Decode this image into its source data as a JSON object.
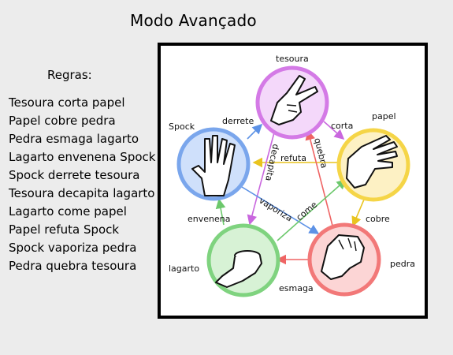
{
  "title": "Modo Avançado",
  "rules": {
    "heading": "Regras:",
    "items": [
      "Tesoura corta papel",
      "Papel cobre pedra",
      "Pedra esmaga lagarto",
      "Lagarto envenena Spock",
      "Spock derrete tesoura",
      "Tesoura decapita lagarto",
      "Lagarto come papel",
      "Papel refuta Spock",
      "Spock vaporiza pedra",
      "Pedra quebra tesoura"
    ]
  },
  "diagram": {
    "nodes": {
      "tesoura": "tesoura",
      "papel": "papel",
      "pedra": "pedra",
      "lagarto": "lagarto",
      "spock": "Spock"
    },
    "edges": {
      "derrete": "derrete",
      "corta": "corta",
      "refuta": "refuta",
      "envenena": "envenena",
      "cobre": "cobre",
      "esmaga": "esmaga"
    },
    "vertical_words": {
      "decapita": "decapita",
      "quebra": "quebra",
      "vaporiza": "vaporiza",
      "come": "come"
    },
    "colors": {
      "tesoura": "#d47ae6",
      "papel": "#f5d547",
      "pedra": "#f27878",
      "lagarto": "#7fd37f",
      "spock": "#7aa6ec"
    }
  }
}
